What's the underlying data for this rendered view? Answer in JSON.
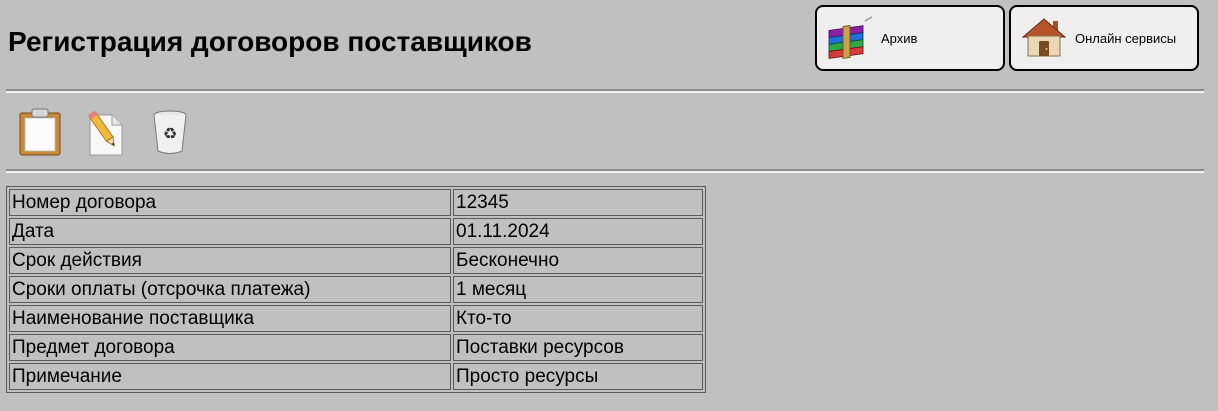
{
  "header": {
    "title": "Регистрация договоров поставщиков"
  },
  "top_buttons": {
    "archive": {
      "label": "Архив",
      "icon": "winrar-archive-icon"
    },
    "online": {
      "label": "Онлайн сервисы",
      "icon": "house-icon"
    }
  },
  "toolbar": {
    "items": [
      {
        "icon": "clipboard-icon"
      },
      {
        "icon": "edit-pencil-document-icon"
      },
      {
        "icon": "recycle-bin-icon"
      }
    ]
  },
  "details": {
    "rows": [
      {
        "label": "Номер договора",
        "value": "12345"
      },
      {
        "label": "Дата",
        "value": "01.11.2024"
      },
      {
        "label": "Срок действия",
        "value": "Бесконечно"
      },
      {
        "label": "Сроки оплаты (отсрочка платежа)",
        "value": "1 месяц"
      },
      {
        "label": "Наименование поставщика",
        "value": "Кто-то"
      },
      {
        "label": "Предмет договора",
        "value": "Поставки ресурсов"
      },
      {
        "label": "Примечание",
        "value": "Просто ресурсы"
      }
    ]
  },
  "colors": {
    "background": "#c0c0c0",
    "button_bg": "#efefef",
    "border": "#5a5a5a"
  }
}
